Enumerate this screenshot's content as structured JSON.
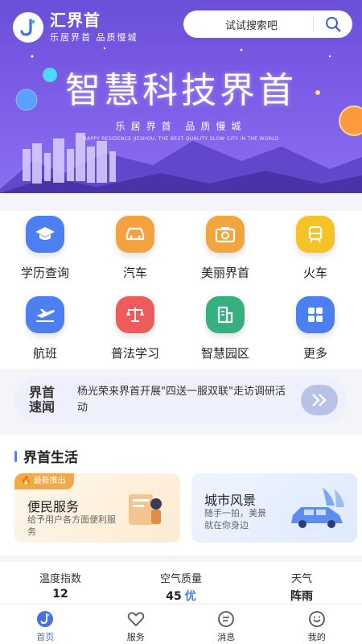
{
  "header": {
    "app_name": "汇界首",
    "app_tagline": "乐居界首  品质慢城",
    "search_placeholder": "试试搜索吧"
  },
  "banner": {
    "title": "智慧科技界首",
    "slogan": "乐居界首  品质慢城",
    "english": "HAPPY RESIDENCE JIESHOU, THE BEST QUALITY SLOW CITY IN THE WORLD"
  },
  "grid": [
    {
      "label": "学历查询",
      "icon": "graduation-cap-icon",
      "color": "#4c7ff0"
    },
    {
      "label": "汽车",
      "icon": "car-icon",
      "color": "#f3a23f"
    },
    {
      "label": "美丽界首",
      "icon": "camera-icon",
      "color": "#f2a53c"
    },
    {
      "label": "火车",
      "icon": "train-icon",
      "color": "#f6c327"
    },
    {
      "label": "航班",
      "icon": "airplane-icon",
      "color": "#4c7ff0"
    },
    {
      "label": "普法学习",
      "icon": "scales-icon",
      "color": "#ee5b5b"
    },
    {
      "label": "智慧园区",
      "icon": "building-icon",
      "color": "#35b07e"
    },
    {
      "label": "更多",
      "icon": "grid-more-icon",
      "color": "#4c7ff0"
    }
  ],
  "news": {
    "logo_line1": "界首",
    "logo_line2": "速闻",
    "text": "杨光荣来界首开展\"四送一服双联\"走访调研活动"
  },
  "life": {
    "title": "界首生活",
    "card1": {
      "badge": "最新推出",
      "title": "便民服务",
      "desc": "给予用户各方面便利服务"
    },
    "card2": {
      "title": "城市风景",
      "desc": "随手一拍，美景就在你身边"
    }
  },
  "stats": [
    {
      "label": "温度指数",
      "value": "12",
      "extra": ""
    },
    {
      "label": "空气质量",
      "value": "45",
      "extra": "优"
    },
    {
      "label": "天气",
      "value": "阵雨",
      "extra": ""
    }
  ],
  "tabs": [
    {
      "label": "首页",
      "icon": "home-icon"
    },
    {
      "label": "服务",
      "icon": "heart-icon"
    },
    {
      "label": "消息",
      "icon": "message-icon"
    },
    {
      "label": "我的",
      "icon": "profile-icon"
    }
  ],
  "colors": {
    "accent": "#4a6fe0",
    "banner": "#7b5ce6"
  }
}
